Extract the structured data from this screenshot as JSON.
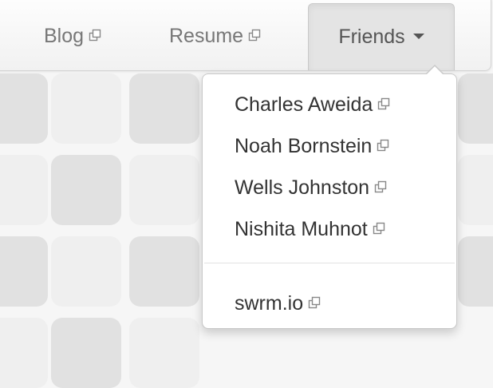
{
  "nav": {
    "blog_label": "Blog",
    "resume_label": "Resume",
    "friends_label": "Friends"
  },
  "dropdown": {
    "friends": [
      "Charles Aweida",
      "Noah Bornstein",
      "Wells Johnston",
      "Nishita Muhnot"
    ],
    "extra_link": "swrm.io"
  },
  "icons": {
    "external": "external-link-icon",
    "caret": "caret-down-icon"
  }
}
